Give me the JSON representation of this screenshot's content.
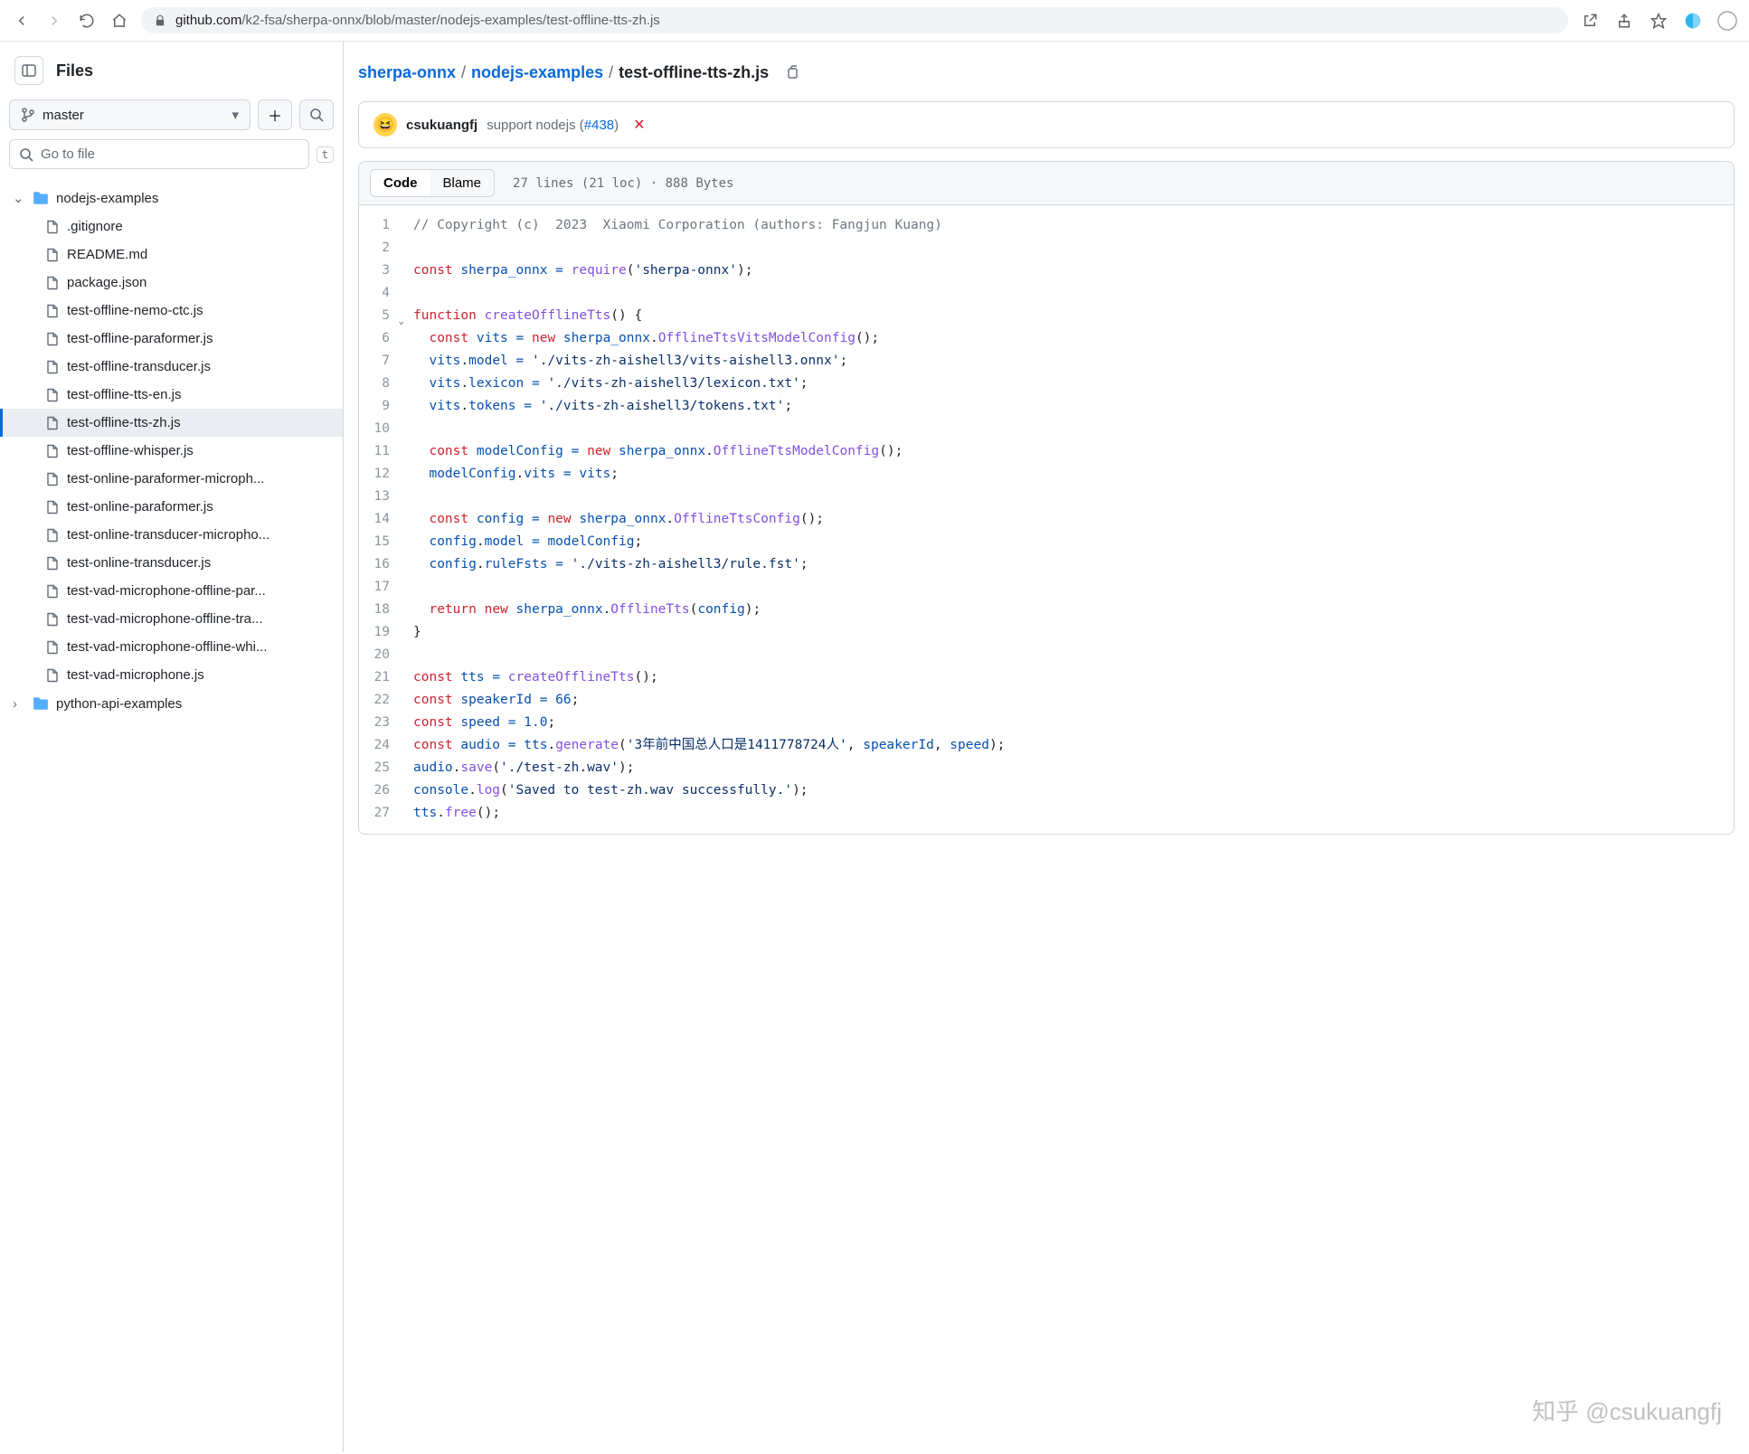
{
  "browser": {
    "url_prefix": "github.com",
    "url_path": "/k2-fsa/sherpa-onnx/blob/master/nodejs-examples/test-offline-tts-zh.js"
  },
  "sidebar": {
    "title": "Files",
    "branch": "master",
    "gotofile_placeholder": "Go to file",
    "kbd": "t",
    "folder_open": "nodejs-examples",
    "files": [
      ".gitignore",
      "README.md",
      "package.json",
      "test-offline-nemo-ctc.js",
      "test-offline-paraformer.js",
      "test-offline-transducer.js",
      "test-offline-tts-en.js",
      "test-offline-tts-zh.js",
      "test-offline-whisper.js",
      "test-online-paraformer-microph...",
      "test-online-paraformer.js",
      "test-online-transducer-micropho...",
      "test-online-transducer.js",
      "test-vad-microphone-offline-par...",
      "test-vad-microphone-offline-tra...",
      "test-vad-microphone-offline-whi...",
      "test-vad-microphone.js"
    ],
    "selected_index": 7,
    "folder_closed": "python-api-examples"
  },
  "breadcrumb": {
    "repo": "sherpa-onnx",
    "dir": "nodejs-examples",
    "file": "test-offline-tts-zh.js"
  },
  "commit": {
    "author": "csukuangfj",
    "msg_prefix": "support nodejs (",
    "pr": "#438",
    "msg_suffix": ")"
  },
  "toolbar": {
    "code": "Code",
    "blame": "Blame",
    "meta": "27 lines (21 loc) · 888 Bytes"
  },
  "code": {
    "lines": 27
  },
  "watermark": "知乎 @csukuangfj"
}
